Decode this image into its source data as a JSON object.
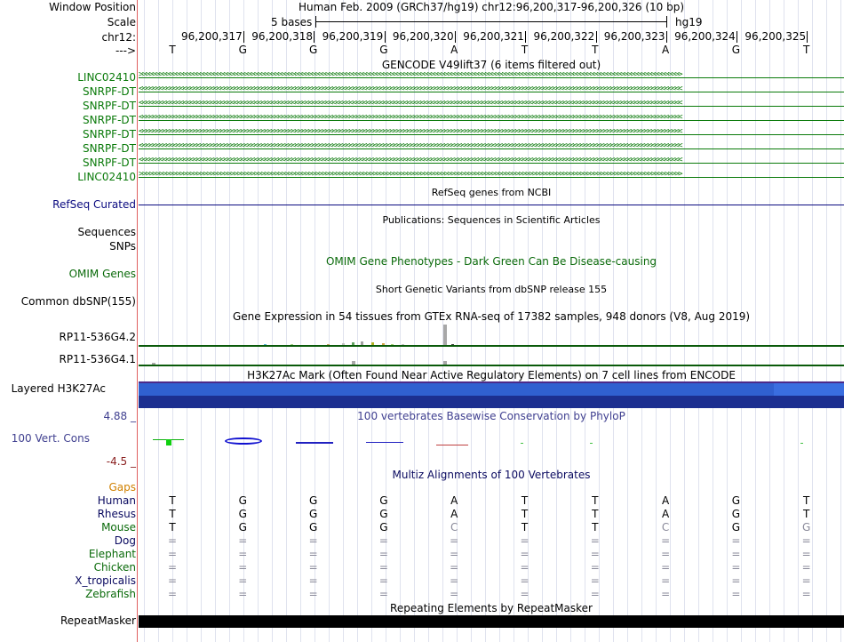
{
  "colors": {
    "gene": "#0a7a0a",
    "refseq": "#0a0a80",
    "omim": "#0a6a0a",
    "phylop": "#404090",
    "multiz": "#0a0a60",
    "gaps": "#d08000",
    "h3k_border": "#4b2a8a",
    "h3k_blue": "#2f5fd0",
    "repeat": "#000000"
  },
  "header": {
    "window_position_label": "Window Position",
    "window_position_text": "Human Feb. 2009 (GRCh37/hg19)   chr12:96,200,317-96,200,326 (10 bp)",
    "scale_label": "Scale",
    "scale_text": "5 bases",
    "scale_assembly": "hg19",
    "chrom_label": "chr12:",
    "strand_label": "--->",
    "positions": [
      "96,200,317",
      "96,200,318",
      "96,200,319",
      "96,200,320",
      "96,200,321",
      "96,200,322",
      "96,200,323",
      "96,200,324",
      "96,200,325"
    ],
    "bases": [
      "T",
      "G",
      "G",
      "G",
      "A",
      "T",
      "T",
      "A",
      "G",
      "T"
    ]
  },
  "gencode": {
    "title": "GENCODE V49lift37 (6 items filtered out)",
    "genes": [
      {
        "name": "LINC02410",
        "direction": "right"
      },
      {
        "name": "SNRPF-DT",
        "direction": "left"
      },
      {
        "name": "SNRPF-DT",
        "direction": "left"
      },
      {
        "name": "SNRPF-DT",
        "direction": "left"
      },
      {
        "name": "SNRPF-DT",
        "direction": "left"
      },
      {
        "name": "SNRPF-DT",
        "direction": "left"
      },
      {
        "name": "SNRPF-DT",
        "direction": "left"
      },
      {
        "name": "LINC02410",
        "direction": "right"
      }
    ]
  },
  "refseq": {
    "title": "RefSeq genes from NCBI",
    "label": "RefSeq Curated"
  },
  "publications": {
    "title": "Publications: Sequences in Scientific Articles",
    "label_line1": "Sequences",
    "label_line2": "SNPs"
  },
  "omim": {
    "title": "OMIM Gene Phenotypes - Dark Green Can Be Disease-causing",
    "label": "OMIM Genes"
  },
  "dbsnp": {
    "title": "Short Genetic Variants from dbSNP release 155",
    "label": "Common dbSNP(155)"
  },
  "gtex": {
    "title": "Gene Expression in 54 tissues from GTEx RNA-seq of 17382 samples, 948 donors (V8, Aug 2019)",
    "genes": [
      {
        "label": "RP11-536G4.2"
      },
      {
        "label": "RP11-536G4.1"
      }
    ]
  },
  "h3k27ac": {
    "title": "H3K27Ac Mark (Often Found Near Active Regulatory Elements) on 7 cell lines from ENCODE",
    "label": "Layered H3K27Ac"
  },
  "phylop": {
    "title": "100 vertebrates Basewise Conservation by PhyloP",
    "label": "100 Vert. Cons",
    "max": "4.88 _",
    "min": "-4.5 _"
  },
  "multiz": {
    "title": "Multiz Alignments of 100 Vertebrates",
    "gaps_label": "Gaps",
    "species": [
      {
        "name": "Human",
        "bases": [
          "T",
          "G",
          "G",
          "G",
          "A",
          "T",
          "T",
          "A",
          "G",
          "T"
        ]
      },
      {
        "name": "Rhesus",
        "bases": [
          "T",
          "G",
          "G",
          "G",
          "A",
          "T",
          "T",
          "A",
          "G",
          "T"
        ]
      },
      {
        "name": "Mouse",
        "bases": [
          "T",
          "G",
          "G",
          "G",
          "C",
          "T",
          "T",
          "C",
          "G",
          "G"
        ]
      },
      {
        "name": "Dog",
        "bases": [
          "=",
          "=",
          "=",
          "=",
          "=",
          "=",
          "=",
          "=",
          "=",
          "="
        ]
      },
      {
        "name": "Elephant",
        "bases": [
          "=",
          "=",
          "=",
          "=",
          "=",
          "=",
          "=",
          "=",
          "=",
          "="
        ]
      },
      {
        "name": "Chicken",
        "bases": [
          "=",
          "=",
          "=",
          "=",
          "=",
          "=",
          "=",
          "=",
          "=",
          "="
        ]
      },
      {
        "name": "X_tropicalis",
        "bases": [
          "=",
          "=",
          "=",
          "=",
          "=",
          "=",
          "=",
          "=",
          "=",
          "="
        ]
      },
      {
        "name": "Zebrafish",
        "bases": [
          "=",
          "=",
          "=",
          "=",
          "=",
          "=",
          "=",
          "=",
          "=",
          "="
        ]
      }
    ]
  },
  "repeatmasker": {
    "title": "Repeating Elements by RepeatMasker",
    "label": "RepeatMasker"
  }
}
